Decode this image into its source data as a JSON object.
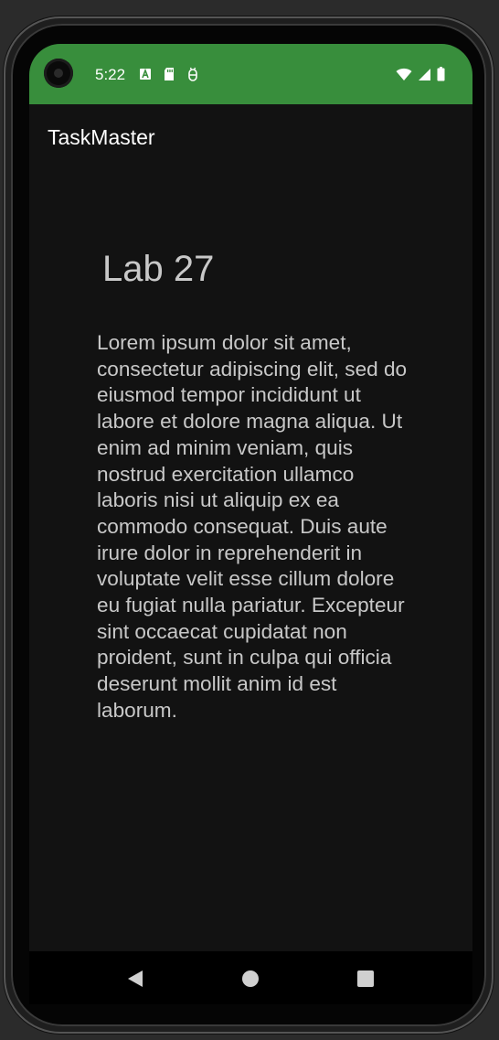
{
  "status_bar": {
    "time": "5:22",
    "notification_icons": [
      "a-icon",
      "sd-card-icon",
      "android-debug-icon"
    ],
    "system_icons": [
      "wifi-icon",
      "signal-icon",
      "battery-icon"
    ],
    "color": "#388e3c"
  },
  "app_bar": {
    "title": "TaskMaster"
  },
  "task": {
    "title": "Lab 27",
    "body": "Lorem ipsum dolor sit amet, consectetur adipiscing elit, sed do eiusmod tempor incididunt ut labore et dolore magna aliqua. Ut enim ad minim veniam, quis nostrud exercitation ullamco laboris nisi ut aliquip ex ea commodo consequat. Duis aute irure dolor in reprehenderit in voluptate velit esse cillum dolore eu fugiat nulla pariatur. Excepteur sint occaecat cupidatat non proident, sunt in culpa qui officia deserunt mollit anim id est laborum."
  },
  "nav_bar": {
    "buttons": [
      "back-icon",
      "home-icon",
      "recents-icon"
    ]
  },
  "theme": {
    "background": "#121212",
    "text": "#c8c8c8"
  }
}
